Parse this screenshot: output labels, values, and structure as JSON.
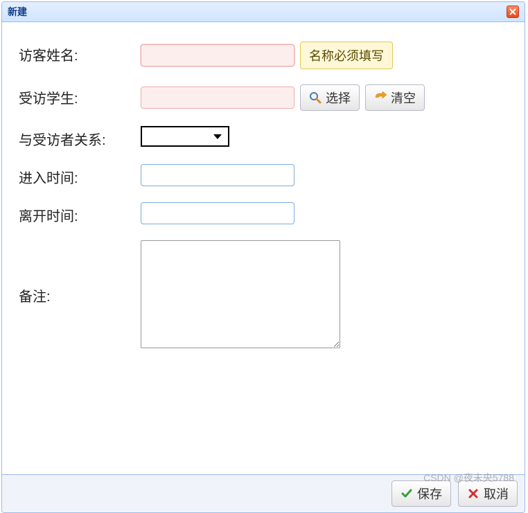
{
  "dialog": {
    "title": "新建"
  },
  "form": {
    "visitor_name": {
      "label": "访客姓名:",
      "value": "",
      "tooltip": "名称必须填写"
    },
    "student": {
      "label": "受访学生:",
      "value": "",
      "select_btn": "选择",
      "clear_btn": "清空"
    },
    "relation": {
      "label": "与受访者关系:",
      "value": ""
    },
    "enter_time": {
      "label": "进入时间:",
      "value": ""
    },
    "leave_time": {
      "label": "离开时间:",
      "value": ""
    },
    "remark": {
      "label": "备注:",
      "value": ""
    }
  },
  "footer": {
    "save": "保存",
    "cancel": "取消"
  },
  "watermark": "CSDN @夜未央5788"
}
